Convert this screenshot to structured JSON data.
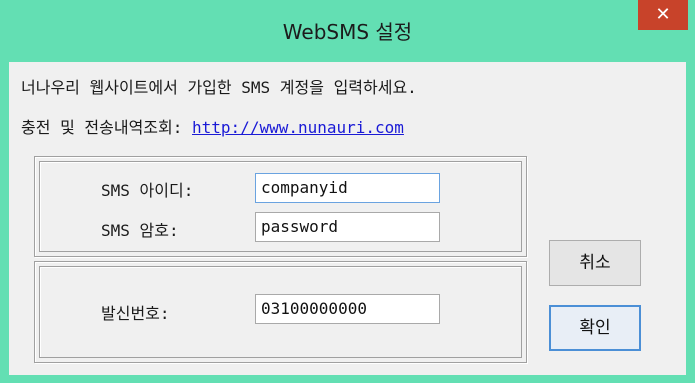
{
  "window": {
    "title": "WebSMS 설정",
    "close_glyph": "✕"
  },
  "intro": {
    "line1": "너나우리 웹사이트에서 가입한 SMS 계정을 입력하세요.",
    "line2_prefix": "충전 및 전송내역조회: ",
    "link_text": "http://www.nunauri.com"
  },
  "account_group": {
    "id_label": "SMS 아이디:",
    "id_value": "companyid",
    "password_label": "SMS 암호:",
    "password_value": "password"
  },
  "sender_group": {
    "sender_label": "발신번호:",
    "sender_value": "03100000000"
  },
  "buttons": {
    "cancel_label": "취소",
    "ok_label": "확인"
  },
  "colors": {
    "titlebar": "#63dfb3",
    "close_button": "#c8432a",
    "link": "#1a1ad6"
  }
}
